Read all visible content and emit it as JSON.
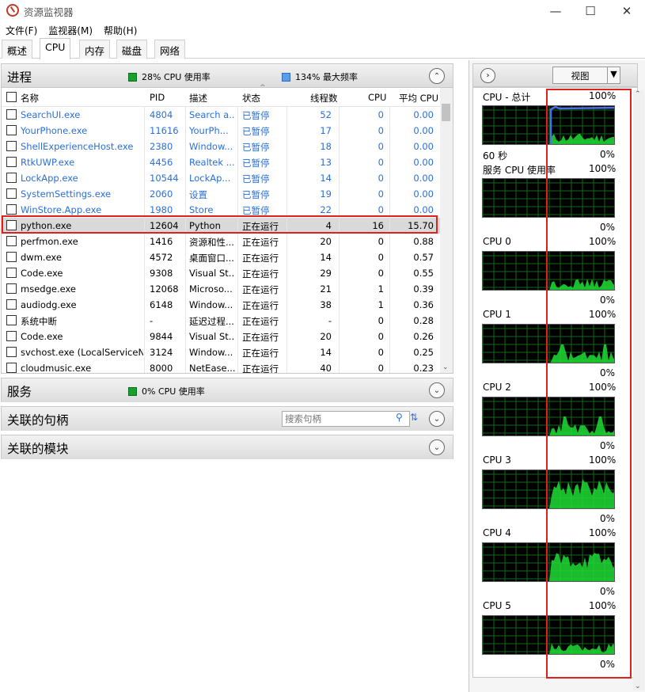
{
  "window": {
    "title": "资源监视器"
  },
  "menu": [
    "文件(F)",
    "监视器(M)",
    "帮助(H)"
  ],
  "tabs": [
    "概述",
    "CPU",
    "内存",
    "磁盘",
    "网络"
  ],
  "process": {
    "header": "进程",
    "cpu_usage_legend": "28% CPU 使用率",
    "max_freq_legend": "134% 最大频率",
    "columns": [
      "名称",
      "PID",
      "描述",
      "状态",
      "线程数",
      "CPU",
      "平均 CPU"
    ],
    "rows": [
      {
        "name": "SearchUI.exe",
        "pid": "4804",
        "desc": "Search a...",
        "status": "已暂停",
        "threads": "52",
        "cpu": "0",
        "avg": "0.00",
        "suspended": true
      },
      {
        "name": "YourPhone.exe",
        "pid": "11616",
        "desc": "YourPh...",
        "status": "已暂停",
        "threads": "17",
        "cpu": "0",
        "avg": "0.00",
        "suspended": true
      },
      {
        "name": "ShellExperienceHost.exe",
        "pid": "2380",
        "desc": "Window...",
        "status": "已暂停",
        "threads": "18",
        "cpu": "0",
        "avg": "0.00",
        "suspended": true
      },
      {
        "name": "RtkUWP.exe",
        "pid": "4456",
        "desc": "Realtek ...",
        "status": "已暂停",
        "threads": "13",
        "cpu": "0",
        "avg": "0.00",
        "suspended": true
      },
      {
        "name": "LockApp.exe",
        "pid": "10544",
        "desc": "LockAp...",
        "status": "已暂停",
        "threads": "14",
        "cpu": "0",
        "avg": "0.00",
        "suspended": true
      },
      {
        "name": "SystemSettings.exe",
        "pid": "2060",
        "desc": "设置",
        "status": "已暂停",
        "threads": "19",
        "cpu": "0",
        "avg": "0.00",
        "suspended": true
      },
      {
        "name": "WinStore.App.exe",
        "pid": "1980",
        "desc": "Store",
        "status": "已暂停",
        "threads": "22",
        "cpu": "0",
        "avg": "0.00",
        "suspended": true
      },
      {
        "name": "python.exe",
        "pid": "12604",
        "desc": "Python",
        "status": "正在运行",
        "threads": "4",
        "cpu": "16",
        "avg": "15.70",
        "suspended": false
      },
      {
        "name": "perfmon.exe",
        "pid": "1416",
        "desc": "资源和性...",
        "status": "正在运行",
        "threads": "20",
        "cpu": "0",
        "avg": "0.88",
        "suspended": false
      },
      {
        "name": "dwm.exe",
        "pid": "4572",
        "desc": "桌面窗口...",
        "status": "正在运行",
        "threads": "14",
        "cpu": "0",
        "avg": "0.57",
        "suspended": false
      },
      {
        "name": "Code.exe",
        "pid": "9308",
        "desc": "Visual St...",
        "status": "正在运行",
        "threads": "29",
        "cpu": "0",
        "avg": "0.55",
        "suspended": false
      },
      {
        "name": "msedge.exe",
        "pid": "12068",
        "desc": "Microso...",
        "status": "正在运行",
        "threads": "21",
        "cpu": "1",
        "avg": "0.39",
        "suspended": false
      },
      {
        "name": "audiodg.exe",
        "pid": "6148",
        "desc": "Window...",
        "status": "正在运行",
        "threads": "38",
        "cpu": "1",
        "avg": "0.36",
        "suspended": false
      },
      {
        "name": "系统中断",
        "pid": "-",
        "desc": "延迟过程...",
        "status": "正在运行",
        "threads": "-",
        "cpu": "0",
        "avg": "0.28",
        "suspended": false
      },
      {
        "name": "Code.exe",
        "pid": "9844",
        "desc": "Visual St...",
        "status": "正在运行",
        "threads": "20",
        "cpu": "0",
        "avg": "0.26",
        "suspended": false
      },
      {
        "name": "svchost.exe (LocalServiceN...",
        "pid": "3124",
        "desc": "Window...",
        "status": "正在运行",
        "threads": "14",
        "cpu": "0",
        "avg": "0.25",
        "suspended": false
      },
      {
        "name": "cloudmusic.exe",
        "pid": "8000",
        "desc": "NetEase...",
        "status": "正在运行",
        "threads": "40",
        "cpu": "0",
        "avg": "0.23",
        "suspended": false
      }
    ]
  },
  "services": {
    "header": "服务",
    "legend": "0% CPU 使用率"
  },
  "handles": {
    "header": "关联的句柄",
    "search_placeholder": "搜索句柄"
  },
  "modules": {
    "header": "关联的模块"
  },
  "right": {
    "view_label": "视图",
    "graphs": [
      {
        "title": "CPU - 总计",
        "max": "100%",
        "min": "0%",
        "time": "60 秒"
      },
      {
        "title": "服务 CPU 使用率",
        "max": "100%",
        "min": "0%"
      },
      {
        "title": "CPU 0",
        "max": "100%",
        "min": "0%"
      },
      {
        "title": "CPU 1",
        "max": "100%",
        "min": "0%"
      },
      {
        "title": "CPU 2",
        "max": "100%",
        "min": "0%"
      },
      {
        "title": "CPU 3",
        "max": "100%",
        "min": "0%"
      },
      {
        "title": "CPU 4",
        "max": "100%",
        "min": "0%"
      },
      {
        "title": "CPU 5",
        "max": "100%",
        "min": "0%"
      }
    ]
  },
  "colors": {
    "suspended_text": "#2a6fdb",
    "graph_green": "#1fdc35",
    "freq_line": "#4a6fe8",
    "highlight_box": "#e0201b",
    "cpu_legend_green": "#17a22f",
    "freq_legend_blue": "#5c9de8"
  }
}
